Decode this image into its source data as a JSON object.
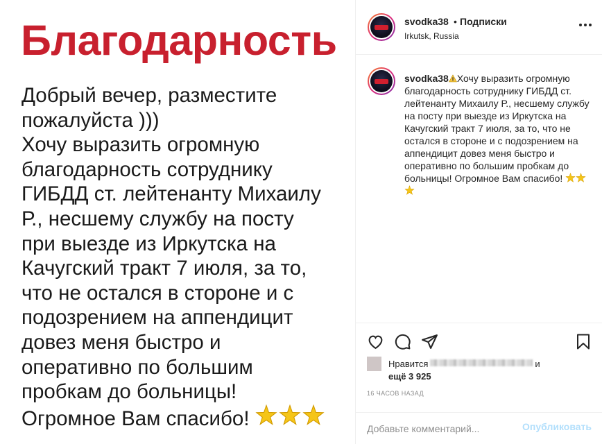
{
  "post_image": {
    "title": "Благодарность",
    "body": "Добрый вечер, разместите\nпожалуйста )))\nХочу выразить огромную\nблагодарность сотруднику\nГИБДД ст. лейтенанту Михаилу\nР., несшему службу на посту\nпри выезде из Иркутска на\nКачугский тракт 7 июля, за то,\nчто не остался в стороне и с\nподозрением на аппендицит\nдовез меня быстро и\nоперативно по большим\nпробкам до больницы!\nОгромное Вам спасибо!",
    "star_icons": [
      "star-icon",
      "star-icon",
      "star-icon"
    ],
    "title_color": "#c8202e"
  },
  "header": {
    "username": "svodka38",
    "separator": "•",
    "follow_label": "Подписки",
    "location": "Irkutsk, Russia"
  },
  "caption": {
    "username": "svodka38",
    "text": "Хочу выразить огромную благодарность сотруднику ГИБДД ст. лейтенанту Михаилу Р., несшему службу на посту при выезде из Иркутска на Качугский тракт 7 июля, за то, что не остался в стороне и с подозрением на аппендицит довез меня быстро и оперативно по большим пробкам до больницы! Огромное Вам спасибо!"
  },
  "likes": {
    "prefix": "Нравится",
    "conjunction": "и",
    "more": "ещё 3 925"
  },
  "timestamp": "16 часов назад",
  "comment": {
    "placeholder": "Добавьте комментарий...",
    "publish_label": "Опубликовать"
  },
  "colors": {
    "publish_disabled": "#b2dffc",
    "border": "#efefef"
  }
}
